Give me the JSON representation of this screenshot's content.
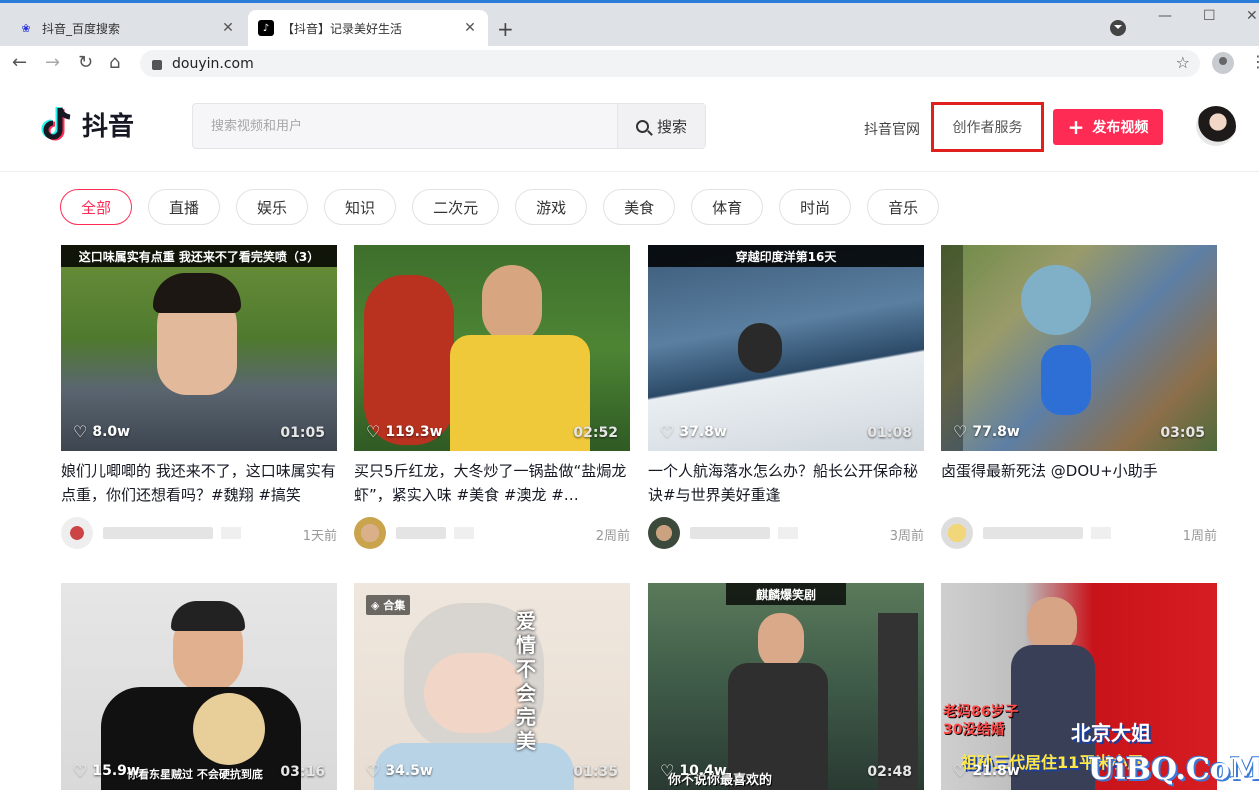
{
  "browser": {
    "tabs": [
      {
        "title": "抖音_百度搜索",
        "active": false,
        "favicon": "baidu-paw-icon"
      },
      {
        "title": "【抖音】记录美好生活",
        "active": true,
        "favicon": "douyin-icon"
      }
    ],
    "new_tab": "+",
    "url": "douyin.com"
  },
  "header": {
    "logo_text": "抖音",
    "search_placeholder": "搜索视频和用户",
    "search_button": "搜索",
    "official_link": "抖音官网",
    "creator_service": "创作者服务",
    "publish_button": "发布视频",
    "accent_color": "#fe2c55",
    "highlight_color": "#e0201c"
  },
  "categories": [
    "全部",
    "直播",
    "娱乐",
    "知识",
    "二次元",
    "游戏",
    "美食",
    "体育",
    "时尚",
    "音乐"
  ],
  "videos": [
    {
      "caption": "这口味属实有点重 我还来不了看完笑喷（3）",
      "likes": "8.0w",
      "duration": "01:05",
      "title": "娘们儿唧唧的 我还来不了，这口味属实有点重，你们还想看吗？#魏翔 #搞笑",
      "time": "1天前"
    },
    {
      "caption": "",
      "likes": "119.3w",
      "duration": "02:52",
      "title": "买只5斤红龙，大冬炒了一锅盐做“盐焗龙虾”，紧实入味 #美食 #澳龙 #…",
      "time": "2周前"
    },
    {
      "caption": "穿越印度洋第16天",
      "likes": "37.8w",
      "duration": "01:08",
      "title": "一个人航海落水怎么办？船长公开保命秘诀#与世界美好重逢",
      "time": "3周前"
    },
    {
      "caption": "",
      "likes": "77.8w",
      "duration": "03:05",
      "title": "卤蛋得最新死法 @DOU+小助手",
      "time": "1周前"
    },
    {
      "caption": "",
      "likes": "15.9w",
      "duration": "03:16",
      "subtitle": "你看东星贼过  不会硬抗到底"
    },
    {
      "caption": "",
      "likes": "34.5w",
      "duration": "01:35",
      "badge": "合集",
      "overlay_text": "爱情不会完美"
    },
    {
      "caption": "麒麟爆笑剧",
      "likes": "10.4w",
      "duration": "02:48",
      "subtitle": "你不说你最喜欢的"
    },
    {
      "caption": "",
      "likes": "21.8w",
      "duration": "",
      "overlay_left": "老妈86岁子30没结婚",
      "overlay_big": "北京大姐",
      "overlay_big2": "祖孙三代居住11平米小屋"
    }
  ],
  "watermark": "UiBQ.CoM"
}
